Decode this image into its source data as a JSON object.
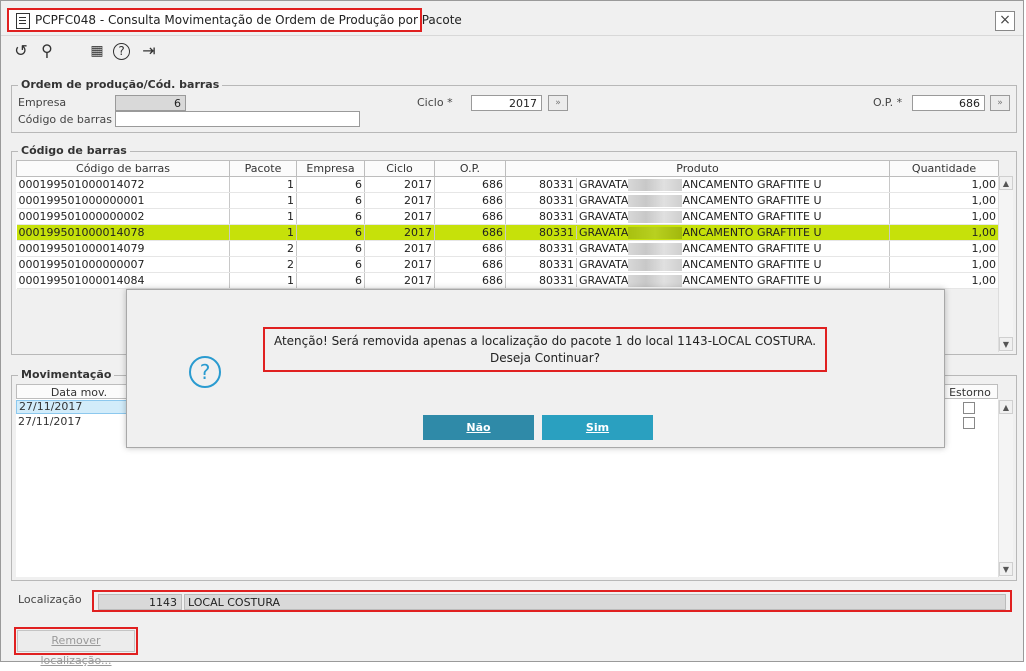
{
  "window": {
    "title": "PCPFC048 - Consulta Movimentação de Ordem de Produção por Pacote",
    "close_label": "×"
  },
  "toolbar": {
    "icons": [
      "refresh-icon",
      "search-icon",
      "calendar-icon",
      "help-icon",
      "exit-icon"
    ],
    "glyphs": {
      "refresh": "↺",
      "search": "⚲",
      "calendar": "▦",
      "help": "?",
      "exit": "⇥"
    }
  },
  "ordem": {
    "legend": "Ordem de produção/Cód. barras",
    "empresa_label": "Empresa",
    "empresa_value": "6",
    "ciclo_label": "Ciclo *",
    "ciclo_value": "2017",
    "op_label": "O.P. *",
    "op_value": "686",
    "codigo_label": "Código de barras",
    "codigo_value": ""
  },
  "codigos": {
    "legend": "Código de barras",
    "columns": [
      "Código de barras",
      "Pacote",
      "Empresa",
      "Ciclo",
      "O.P.",
      "Produto",
      "Quantidade"
    ],
    "rows": [
      {
        "codigo": "000199501000014072",
        "pacote": "1",
        "empresa": "6",
        "ciclo": "2017",
        "op": "686",
        "prod_code": "80331",
        "prod_a": "GRAVATA",
        "prod_b": "ANCAMENTO GRAFTITE U",
        "qtd": "1,00",
        "selected": false
      },
      {
        "codigo": "000199501000000001",
        "pacote": "1",
        "empresa": "6",
        "ciclo": "2017",
        "op": "686",
        "prod_code": "80331",
        "prod_a": "GRAVATA",
        "prod_b": "ANCAMENTO GRAFTITE U",
        "qtd": "1,00",
        "selected": false
      },
      {
        "codigo": "000199501000000002",
        "pacote": "1",
        "empresa": "6",
        "ciclo": "2017",
        "op": "686",
        "prod_code": "80331",
        "prod_a": "GRAVATA",
        "prod_b": "ANCAMENTO GRAFTITE U",
        "qtd": "1,00",
        "selected": false
      },
      {
        "codigo": "000199501000014078",
        "pacote": "1",
        "empresa": "6",
        "ciclo": "2017",
        "op": "686",
        "prod_code": "80331",
        "prod_a": "GRAVATA",
        "prod_b": "ANCAMENTO GRAFTITE U",
        "qtd": "1,00",
        "selected": true
      },
      {
        "codigo": "000199501000014079",
        "pacote": "2",
        "empresa": "6",
        "ciclo": "2017",
        "op": "686",
        "prod_code": "80331",
        "prod_a": "GRAVATA",
        "prod_b": "ANCAMENTO GRAFTITE U",
        "qtd": "1,00",
        "selected": false
      },
      {
        "codigo": "000199501000000007",
        "pacote": "2",
        "empresa": "6",
        "ciclo": "2017",
        "op": "686",
        "prod_code": "80331",
        "prod_a": "GRAVATA",
        "prod_b": "ANCAMENTO GRAFTITE U",
        "qtd": "1,00",
        "selected": false
      },
      {
        "codigo": "000199501000014084",
        "pacote": "1",
        "empresa": "6",
        "ciclo": "2017",
        "op": "686",
        "prod_code": "80331",
        "prod_a": "GRAVATA",
        "prod_b": "ANCAMENTO GRAFTITE U",
        "qtd": "1,00",
        "selected": false
      }
    ]
  },
  "movimentacao": {
    "legend": "Movimentação",
    "col_data": "Data mov.",
    "col_estorno": "Estorno",
    "rows": [
      {
        "data": "27/11/2017",
        "estorno": false,
        "selected": true
      },
      {
        "data": "27/11/2017",
        "estorno": false,
        "selected": false
      }
    ]
  },
  "localizacao": {
    "label": "Localização",
    "code": "1143",
    "name": "LOCAL COSTURA"
  },
  "remove_button": "Remover localização...",
  "dialog": {
    "icon": "?",
    "line1": "Atenção! Será removida apenas a localização do pacote 1 do local 1143-LOCAL COSTURA.",
    "line2": "Deseja Continuar?",
    "no_label": "Não",
    "yes_label": "Sim"
  },
  "colors": {
    "highlight": "#c6e10a",
    "annotation_red": "#e02020",
    "dialog_button": "#2f8aa8",
    "question_icon": "#2a9bd0"
  }
}
